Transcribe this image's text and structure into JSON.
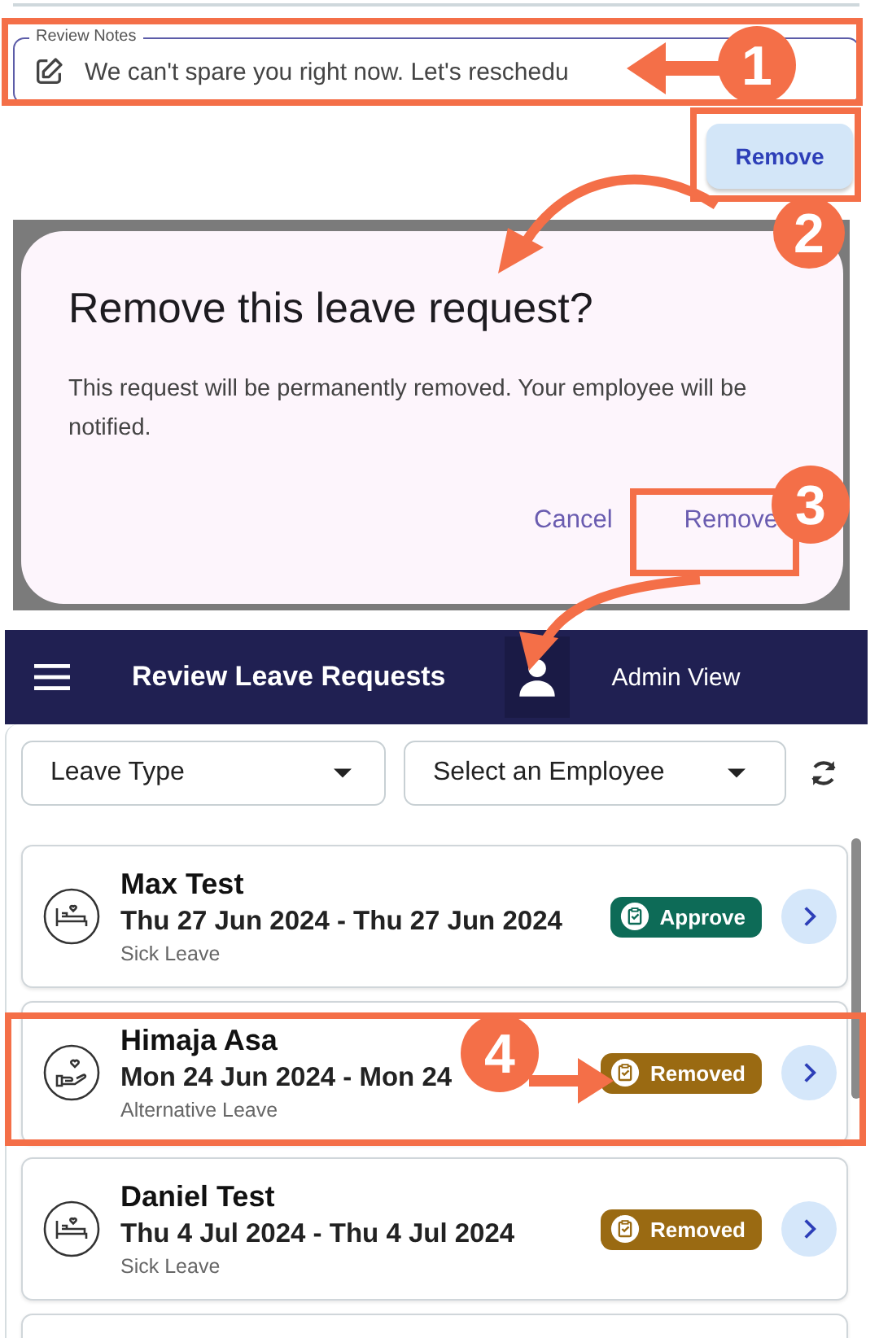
{
  "review_notes": {
    "label": "Review Notes",
    "value": "We can't spare you right now. Let's reschedu"
  },
  "remove_button": {
    "label": "Remove"
  },
  "dialog": {
    "title": "Remove this leave request?",
    "message": "This request will be permanently removed. Your employee will be notified.",
    "buttons": [
      "Cancel",
      "Remove"
    ]
  },
  "app_bar": {
    "title": "Review Leave Requests",
    "account": "Admin View"
  },
  "filters": [
    "Leave Type",
    "Select an Employee"
  ],
  "requests": [
    {
      "name": "Max Test",
      "dates": "Thu 27 Jun 2024 - Thu 27 Jun 2024",
      "leave_type": "Sick Leave",
      "kind": "sick",
      "status": "Approve",
      "color": "#0d6b57"
    },
    {
      "name": "Himaja Asa",
      "dates": "Mon 24 Jun 2024 - Mon 24",
      "leave_type": "Alternative Leave",
      "kind": "alternative",
      "status": "Removed",
      "color": "#9a6a12"
    },
    {
      "name": "Daniel Test",
      "dates": "Thu 4 Jul 2024 - Thu 4 Jul 2024",
      "leave_type": "Sick Leave",
      "kind": "sick",
      "status": "Removed",
      "color": "#9a6a12"
    }
  ],
  "annotations": [
    {
      "number": "1"
    },
    {
      "number": "2"
    },
    {
      "number": "3"
    },
    {
      "number": "4"
    }
  ]
}
